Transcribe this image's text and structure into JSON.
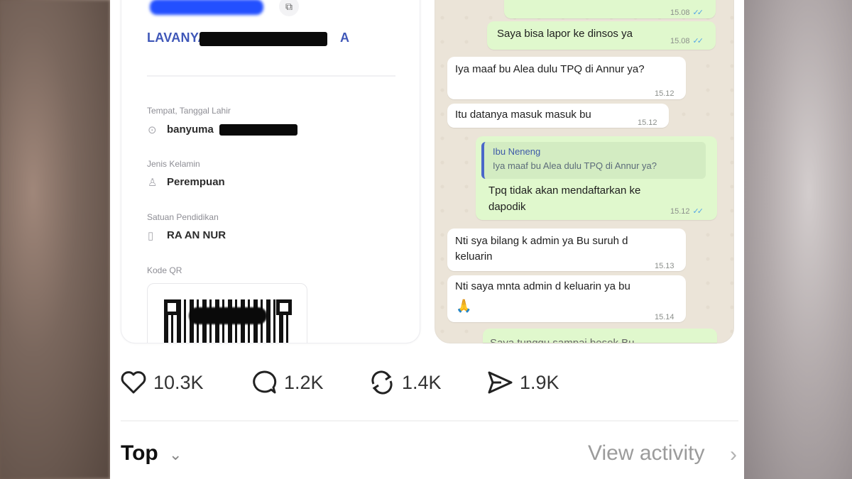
{
  "id_card": {
    "name_visible": "LAVANYA A",
    "name_tail": "A",
    "birth_label": "Tempat, Tanggal Lahir",
    "birth_value": "banyuma",
    "gender_label": "Jenis Kelamin",
    "gender_value": "Perempuan",
    "school_label": "Satuan Pendidikan",
    "school_value": "RA AN NUR",
    "qr_label": "Kode QR"
  },
  "chat": {
    "messages": [
      {
        "dir": "out",
        "text": "",
        "time": "15.08"
      },
      {
        "dir": "out",
        "text": "Saya bisa lapor ke dinsos ya",
        "time": "15.08"
      },
      {
        "dir": "in",
        "text": "Iya maaf bu Alea dulu TPQ di Annur ya?",
        "time": "15.12"
      },
      {
        "dir": "in",
        "text": "Itu datanya masuk masuk bu",
        "time": "15.12"
      },
      {
        "dir": "out",
        "quote_name": "Ibu Neneng",
        "quote_text": "Iya maaf bu Alea dulu TPQ di Annur ya?",
        "text": "Tpq tidak akan mendaftarkan ke dapodik",
        "time": "15.12"
      },
      {
        "dir": "in",
        "text": "Nti sya bilang k admin ya Bu suruh d keluarin",
        "time": "15.13"
      },
      {
        "dir": "in",
        "text": "Nti saya mnta admin d keluarin ya bu",
        "emoji": "🙏",
        "time": "15.14"
      },
      {
        "dir": "out",
        "text": "Saya tunggu sampai besok Bu",
        "time": ""
      }
    ]
  },
  "actions": {
    "likes": "10.3K",
    "comments": "1.2K",
    "reposts": "1.4K",
    "shares": "1.9K"
  },
  "footer": {
    "sort_label": "Top",
    "view_activity": "View activity"
  },
  "icons": {
    "like": "heart-icon",
    "comment": "speech-bubble-icon",
    "repost": "repost-arrows-icon",
    "share": "send-icon"
  },
  "colors": {
    "chat_out": "#e0f8cd",
    "chat_in": "#ffffff",
    "tick_blue": "#53a6e6",
    "name_blue": "#3f57b8"
  }
}
